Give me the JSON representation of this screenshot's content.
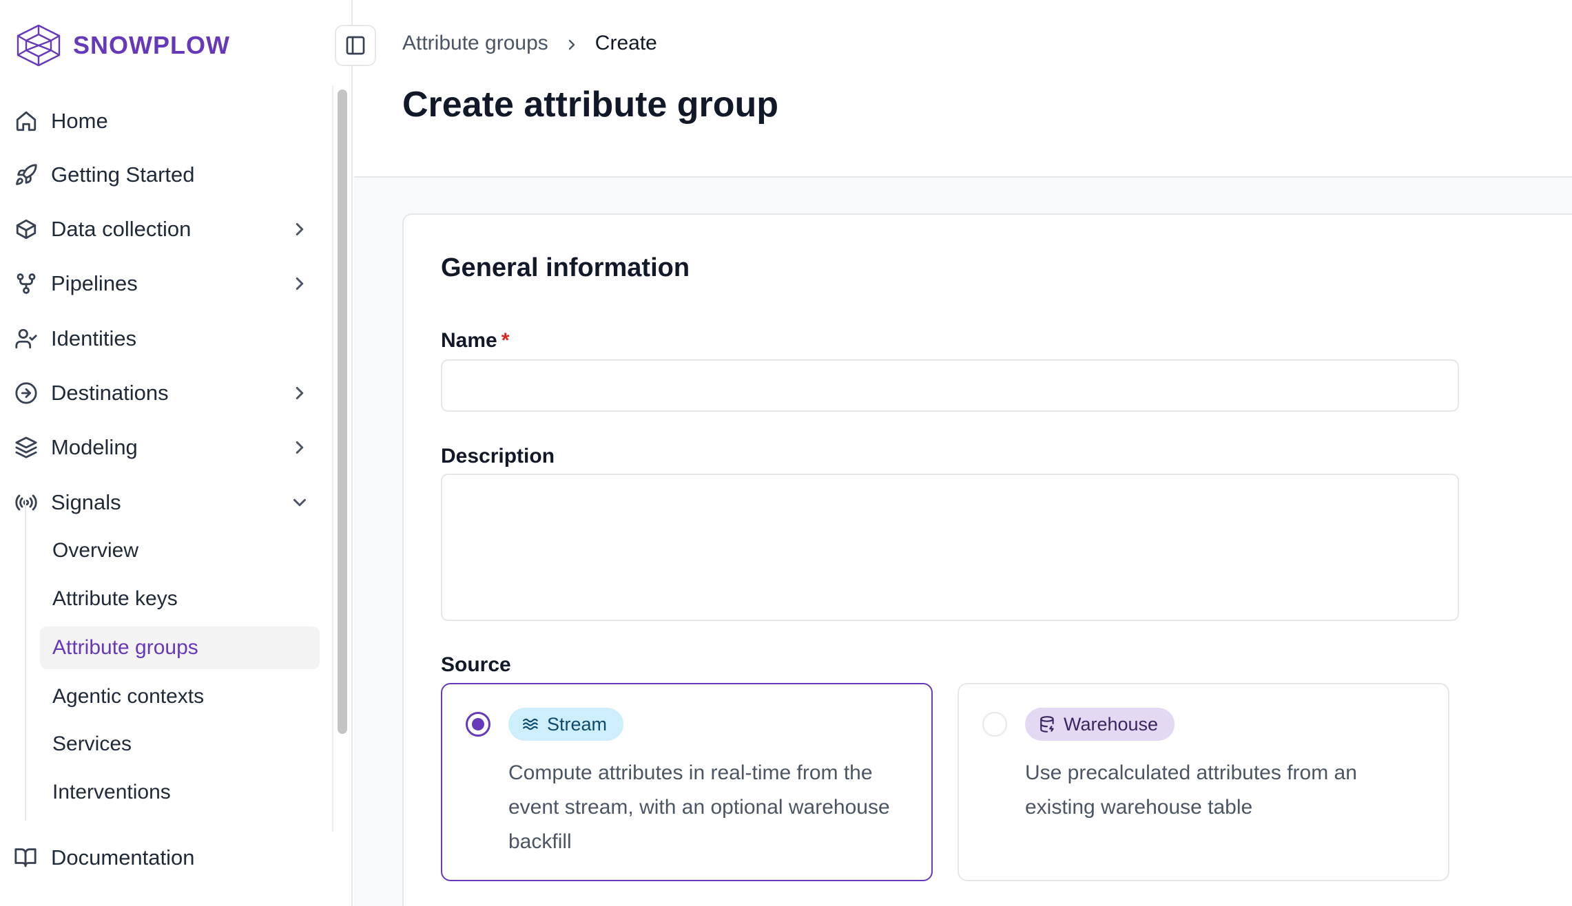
{
  "brand": {
    "name": "SNOWPLOW",
    "color": "#6639ba"
  },
  "sidebar": {
    "items": [
      {
        "label": "Home",
        "icon": "home-icon",
        "has_chevron": false
      },
      {
        "label": "Getting Started",
        "icon": "rocket-icon",
        "has_chevron": false
      },
      {
        "label": "Data collection",
        "icon": "box-icon",
        "has_chevron": true
      },
      {
        "label": "Pipelines",
        "icon": "workflow-icon",
        "has_chevron": true
      },
      {
        "label": "Identities",
        "icon": "user-check-icon",
        "has_chevron": false
      },
      {
        "label": "Destinations",
        "icon": "arrow-circle-right-icon",
        "has_chevron": true
      },
      {
        "label": "Modeling",
        "icon": "layers-icon",
        "has_chevron": true
      },
      {
        "label": "Signals",
        "icon": "radio-signal-icon",
        "has_chevron": true,
        "expanded": true
      }
    ],
    "signals_children": [
      {
        "label": "Overview"
      },
      {
        "label": "Attribute keys"
      },
      {
        "label": "Attribute groups",
        "active": true
      },
      {
        "label": "Agentic contexts"
      },
      {
        "label": "Services"
      },
      {
        "label": "Interventions"
      }
    ],
    "documentation": {
      "label": "Documentation",
      "icon": "book-open-icon"
    }
  },
  "header": {
    "breadcrumb": {
      "parent": "Attribute groups",
      "current": "Create"
    },
    "title": "Create attribute group"
  },
  "form": {
    "section_title": "General information",
    "name": {
      "label": "Name",
      "required_mark": "*",
      "value": "",
      "placeholder": ""
    },
    "description": {
      "label": "Description",
      "value": "",
      "placeholder": ""
    },
    "source": {
      "label": "Source",
      "options": [
        {
          "tag": "Stream",
          "icon": "waves-icon",
          "selected": true,
          "description": "Compute attributes in real-time from the event stream, with an optional warehouse backfill"
        },
        {
          "tag": "Warehouse",
          "icon": "database-icon",
          "selected": false,
          "description": "Use precalculated attributes from an existing warehouse table"
        }
      ]
    }
  }
}
